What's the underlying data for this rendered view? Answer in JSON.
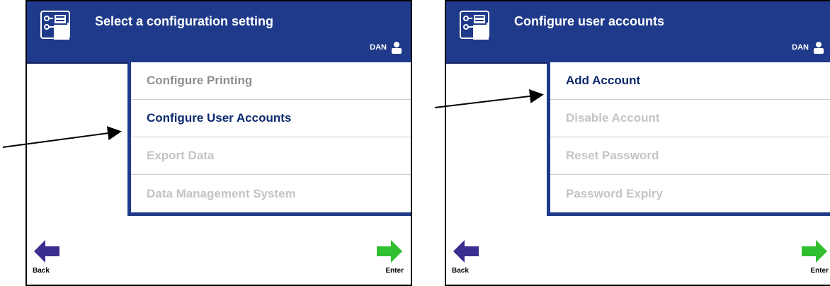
{
  "screens": [
    {
      "title": "Select a configuration setting",
      "user": "DAN",
      "menu": [
        {
          "label": "Configure Printing",
          "state": "normal"
        },
        {
          "label": "Configure User Accounts",
          "state": "selected"
        },
        {
          "label": "Export Data",
          "state": "dimmed"
        },
        {
          "label": "Data Management System",
          "state": "dimmed"
        }
      ],
      "back_label": "Back",
      "enter_label": "Enter"
    },
    {
      "title": "Configure user accounts",
      "user": "DAN",
      "menu": [
        {
          "label": "Add Account",
          "state": "selected"
        },
        {
          "label": "Disable Account",
          "state": "dimmed"
        },
        {
          "label": "Reset Password",
          "state": "dimmed"
        },
        {
          "label": "Password Expiry",
          "state": "dimmed"
        }
      ],
      "back_label": "Back",
      "enter_label": "Enter"
    }
  ],
  "colors": {
    "titlebar": "#1f3a8a",
    "selected_text": "#0d2a6e",
    "back_arrow": "#3a2f8f",
    "enter_arrow": "#2fbf2f"
  },
  "icons": {
    "app": "configuration-icon",
    "user": "user-icon",
    "back": "left-arrow-icon",
    "enter": "right-arrow-icon"
  }
}
